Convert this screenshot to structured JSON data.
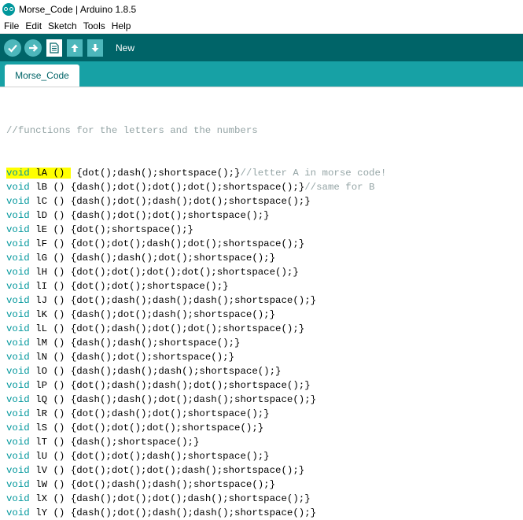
{
  "window": {
    "title": "Morse_Code | Arduino 1.8.5"
  },
  "menu": [
    "File",
    "Edit",
    "Sketch",
    "Tools",
    "Help"
  ],
  "toolbar": {
    "buttons": [
      "verify-icon",
      "upload-icon",
      "new-icon",
      "open-icon",
      "save-icon"
    ],
    "label": "New"
  },
  "tabs": [
    {
      "label": "Morse_Code"
    }
  ],
  "editor": {
    "comment_line": "//functions for the letters and the numbers",
    "lines": [
      {
        "kw": "void",
        "name": "lA",
        "args": "()",
        "body": "{dot();dash();shortspace();}",
        "comment": "//letter A in morse code!"
      },
      {
        "kw": "void",
        "name": "lB",
        "args": "()",
        "body": "{dash();dot();dot();dot();shortspace();}",
        "comment": "//same for B"
      },
      {
        "kw": "void",
        "name": "lC",
        "args": "()",
        "body": "{dash();dot();dash();dot();shortspace();}",
        "comment": ""
      },
      {
        "kw": "void",
        "name": "lD",
        "args": "()",
        "body": "{dash();dot();dot();shortspace();}",
        "comment": ""
      },
      {
        "kw": "void",
        "name": "lE",
        "args": "()",
        "body": "{dot();shortspace();}",
        "comment": ""
      },
      {
        "kw": "void",
        "name": "lF",
        "args": "()",
        "body": "{dot();dot();dash();dot();shortspace();}",
        "comment": ""
      },
      {
        "kw": "void",
        "name": "lG",
        "args": "()",
        "body": "{dash();dash();dot();shortspace();}",
        "comment": ""
      },
      {
        "kw": "void",
        "name": "lH",
        "args": "()",
        "body": "{dot();dot();dot();dot();shortspace();}",
        "comment": ""
      },
      {
        "kw": "void",
        "name": "lI",
        "args": "()",
        "body": "{dot();dot();shortspace();}",
        "comment": ""
      },
      {
        "kw": "void",
        "name": "lJ",
        "args": "()",
        "body": "{dot();dash();dash();dash();shortspace();}",
        "comment": ""
      },
      {
        "kw": "void",
        "name": "lK",
        "args": "()",
        "body": "{dash();dot();dash();shortspace();}",
        "comment": ""
      },
      {
        "kw": "void",
        "name": "lL",
        "args": "()",
        "body": "{dot();dash();dot();dot();shortspace();}",
        "comment": ""
      },
      {
        "kw": "void",
        "name": "lM",
        "args": "()",
        "body": "{dash();dash();shortspace();}",
        "comment": ""
      },
      {
        "kw": "void",
        "name": "lN",
        "args": "()",
        "body": "{dash();dot();shortspace();}",
        "comment": ""
      },
      {
        "kw": "void",
        "name": "lO",
        "args": "()",
        "body": "{dash();dash();dash();shortspace();}",
        "comment": ""
      },
      {
        "kw": "void",
        "name": "lP",
        "args": "()",
        "body": "{dot();dash();dash();dot();shortspace();}",
        "comment": ""
      },
      {
        "kw": "void",
        "name": "lQ",
        "args": "()",
        "body": "{dash();dash();dot();dash();shortspace();}",
        "comment": ""
      },
      {
        "kw": "void",
        "name": "lR",
        "args": "()",
        "body": "{dot();dash();dot();shortspace();}",
        "comment": ""
      },
      {
        "kw": "void",
        "name": "lS",
        "args": "()",
        "body": "{dot();dot();dot();shortspace();}",
        "comment": ""
      },
      {
        "kw": "void",
        "name": "lT",
        "args": "()",
        "body": "{dash();shortspace();}",
        "comment": ""
      },
      {
        "kw": "void",
        "name": "lU",
        "args": "()",
        "body": "{dot();dot();dash();shortspace();}",
        "comment": ""
      },
      {
        "kw": "void",
        "name": "lV",
        "args": "()",
        "body": "{dot();dot();dot();dash();shortspace();}",
        "comment": ""
      },
      {
        "kw": "void",
        "name": "lW",
        "args": "()",
        "body": "{dot();dash();dash();shortspace();}",
        "comment": ""
      },
      {
        "kw": "void",
        "name": "lX",
        "args": "()",
        "body": "{dash();dot();dot();dash();shortspace();}",
        "comment": ""
      },
      {
        "kw": "void",
        "name": "lY",
        "args": "()",
        "body": "{dash();dot();dash();dash();shortspace();}",
        "comment": ""
      }
    ]
  },
  "colors": {
    "toolbar": "#006468",
    "tabstrip": "#17a1a5",
    "keyword": "#00979c",
    "comment": "#95a5a6",
    "highlight": "#ffff00"
  }
}
